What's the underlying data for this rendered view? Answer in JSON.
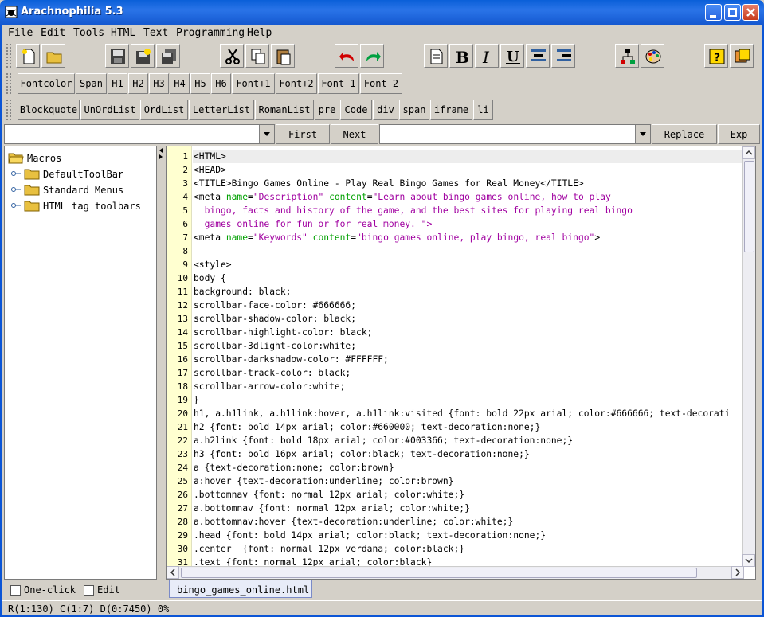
{
  "window": {
    "title": "Arachnophilia 5.3"
  },
  "menu": [
    "File",
    "Edit",
    "Tools",
    "HTML",
    "Text",
    "Programming",
    "Help"
  ],
  "toolbar_icons": [
    "new-file-icon",
    "open-folder-icon",
    "save-icon",
    "save-as-icon",
    "save-all-icon",
    "cut-icon",
    "copy-icon",
    "paste-icon",
    "undo-icon",
    "redo-icon",
    "document-icon",
    "bold-icon",
    "italic-icon",
    "underline-icon",
    "center-icon",
    "right-align-icon",
    "tree-icon",
    "palette-icon",
    "help-icon",
    "preferences-icon"
  ],
  "html_toolbar_1": [
    "Fontcolor",
    "Span",
    "H1",
    "H2",
    "H3",
    "H4",
    "H5",
    "H6",
    "Font+1",
    "Font+2",
    "Font-1",
    "Font-2"
  ],
  "html_toolbar_2": [
    "Blockquote",
    "UnOrdList",
    "OrdList",
    "LetterList",
    "RomanList",
    "pre",
    "Code",
    "div",
    "span",
    "iframe",
    "li"
  ],
  "search": {
    "find_value": "",
    "first": "First",
    "next": "Next",
    "replace_value": "",
    "replace": "Replace",
    "exp": "Exp"
  },
  "tree": {
    "root": "Macros",
    "children": [
      "DefaultToolBar",
      "Standard Menus",
      "HTML tag toolbars"
    ]
  },
  "left_options": {
    "one_click": "One-click",
    "edit": "Edit"
  },
  "editor": {
    "tab": "bingo_games_online.html",
    "lines": [
      {
        "n": "1",
        "t": "<HTML>"
      },
      {
        "n": "2",
        "t": "<HEAD>"
      },
      {
        "n": "3",
        "t": "<TITLE>Bingo Games Online - Play Real Bingo Games for Real Money</TITLE>"
      },
      {
        "n": "4",
        "t": "<meta name=\"Description\" content=\"Learn about bingo games online, how to play"
      },
      {
        "n": "5",
        "t": "  bingo, facts and history of the game, and the best sites for playing real bingo"
      },
      {
        "n": "6",
        "t": "  games online for fun or for real money. \">"
      },
      {
        "n": "7",
        "t": "<meta name=\"Keywords\" content=\"bingo games online, play bingo, real bingo\">"
      },
      {
        "n": "8",
        "t": ""
      },
      {
        "n": "9",
        "t": "<style>"
      },
      {
        "n": "10",
        "t": "body {"
      },
      {
        "n": "11",
        "t": "background: black;"
      },
      {
        "n": "12",
        "t": "scrollbar-face-color: #666666;"
      },
      {
        "n": "13",
        "t": "scrollbar-shadow-color: black;"
      },
      {
        "n": "14",
        "t": "scrollbar-highlight-color: black;"
      },
      {
        "n": "15",
        "t": "scrollbar-3dlight-color:white;"
      },
      {
        "n": "16",
        "t": "scrollbar-darkshadow-color: #FFFFFF;"
      },
      {
        "n": "17",
        "t": "scrollbar-track-color: black;"
      },
      {
        "n": "18",
        "t": "scrollbar-arrow-color:white;"
      },
      {
        "n": "19",
        "t": "}"
      },
      {
        "n": "20",
        "t": "h1, a.h1link, a.h1link:hover, a.h1link:visited {font: bold 22px arial; color:#666666; text-decorati"
      },
      {
        "n": "21",
        "t": "h2 {font: bold 14px arial; color:#660000; text-decoration:none;}"
      },
      {
        "n": "22",
        "t": "a.h2link {font: bold 18px arial; color:#003366; text-decoration:none;}"
      },
      {
        "n": "23",
        "t": "h3 {font: bold 16px arial; color:black; text-decoration:none;}"
      },
      {
        "n": "24",
        "t": "a {text-decoration:none; color:brown}"
      },
      {
        "n": "25",
        "t": "a:hover {text-decoration:underline; color:brown}"
      },
      {
        "n": "26",
        "t": ".bottomnav {font: normal 12px arial; color:white;}"
      },
      {
        "n": "27",
        "t": "a.bottomnav {font: normal 12px arial; color:white;}"
      },
      {
        "n": "28",
        "t": "a.bottomnav:hover {text-decoration:underline; color:white;}"
      },
      {
        "n": "29",
        "t": ".head {font: bold 14px arial; color:black; text-decoration:none;}"
      },
      {
        "n": "30",
        "t": ".center  {font: normal 12px verdana; color:black;}"
      },
      {
        "n": "31",
        "t": ".text {font: normal 12px arial; color:black}"
      }
    ]
  },
  "status": "R(1:130) C(1:7) D(0:7450) 0%",
  "colors": {
    "tag": "#000080",
    "attr": "#00a000",
    "value": "#a000a0",
    "gutter": "#ffffd0",
    "title_bar": "#0a5fd8"
  }
}
